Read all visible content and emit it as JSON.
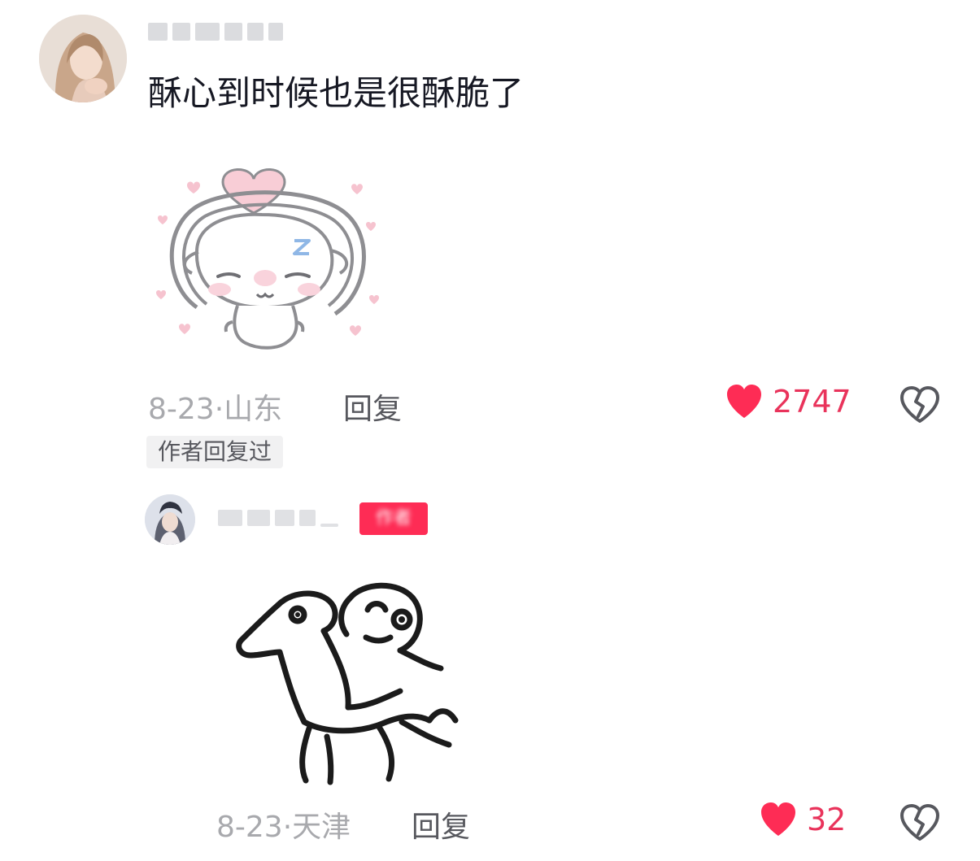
{
  "comment": {
    "username": "",
    "text": "酥心到时候也是很酥脆了",
    "sticker_icon": "sleeping-cat-heart-sticker",
    "date": "8-23",
    "location": "山东",
    "reply_label": "回复",
    "like_count": "2747",
    "author_replied_label": "作者回复过"
  },
  "reply": {
    "username": "",
    "author_badge": "作者",
    "sticker_icon": "doodle-horse-rider-sticker",
    "date": "8-23",
    "location": "天津",
    "reply_label": "回复",
    "like_count": "32"
  },
  "colors": {
    "like_red": "#fe2c55",
    "meta_gray": "#a8a9ad",
    "text_dark": "#161823"
  },
  "icons": {
    "like": "heart-filled-icon",
    "dislike": "broken-heart-icon"
  }
}
